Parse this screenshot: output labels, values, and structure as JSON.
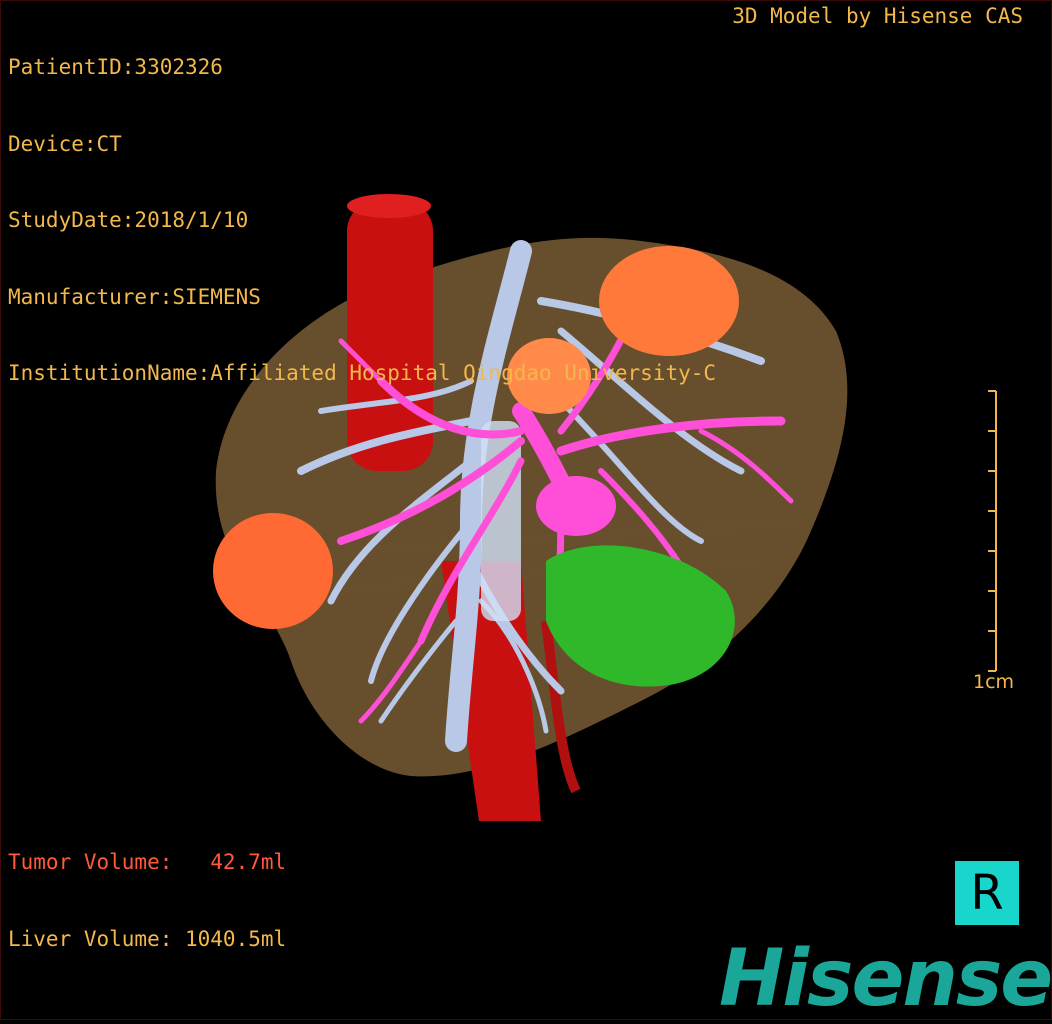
{
  "header": {
    "patient_id": "PatientID:3302326",
    "device": "Device:CT",
    "study_date": "StudyDate:2018/1/10",
    "manufacturer": "Manufacturer:SIEMENS",
    "institution": "InstitutionName:Affiliated Hospital Qingdao University-C"
  },
  "credit": "3D Model by Hisense CAS",
  "volumes": {
    "tumor": "Tumor Volume:   42.7ml",
    "liver": "Liver Volume: 1040.5ml"
  },
  "scale": {
    "label": "1cm"
  },
  "orientation": {
    "label": "R"
  },
  "logo": {
    "text": "Hisense"
  },
  "colors": {
    "overlay_text": "#f2b84b",
    "tumor_text": "#ff5a3a",
    "liver": "#8a6a3c",
    "tumor": "#ff7a3a",
    "artery": "#c81010",
    "portal_vein": "#ff4fd8",
    "hepatic_vein": "#b8c8e6",
    "gallbladder": "#2fb82a",
    "orientation_box": "#19d6cc",
    "logo": "#1aa79a"
  }
}
